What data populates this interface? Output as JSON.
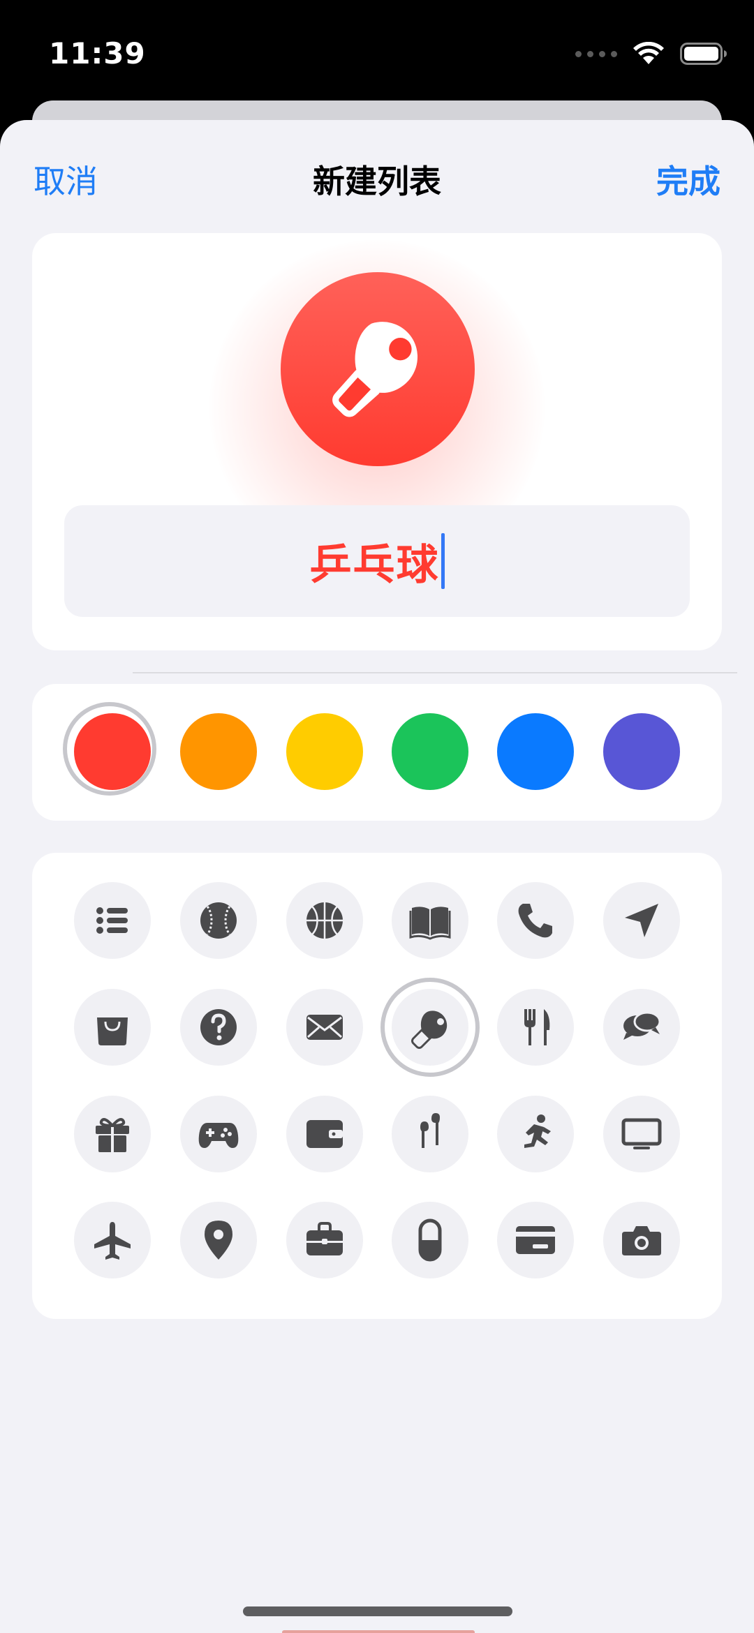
{
  "status_bar": {
    "time": "11:39"
  },
  "nav": {
    "cancel": "取消",
    "title": "新建列表",
    "done": "完成"
  },
  "list": {
    "name": "乒乓球",
    "accent_color": "#ff3b30",
    "selected_icon": "ping-pong-paddle-icon"
  },
  "colors": [
    {
      "name": "red",
      "hex": "#ff3b30",
      "selected": true
    },
    {
      "name": "orange",
      "hex": "#ff9500",
      "selected": false
    },
    {
      "name": "yellow",
      "hex": "#ffcc00",
      "selected": false
    },
    {
      "name": "green",
      "hex": "#1bc45a",
      "selected": false
    },
    {
      "name": "blue",
      "hex": "#0a7aff",
      "selected": false
    },
    {
      "name": "purple",
      "hex": "#5856d6",
      "selected": false
    }
  ],
  "icons": [
    "list-icon",
    "baseball-icon",
    "basketball-icon",
    "book-icon",
    "phone-icon",
    "location-arrow-icon",
    "shopping-bag-icon",
    "question-icon",
    "mail-icon",
    "ping-pong-paddle-icon",
    "fork-knife-icon",
    "chat-bubbles-icon",
    "gift-icon",
    "gamepad-icon",
    "wallet-icon",
    "earbuds-icon",
    "running-icon",
    "tv-icon",
    "airplane-icon",
    "map-pin-icon",
    "briefcase-icon",
    "pill-icon",
    "credit-card-icon",
    "camera-icon"
  ]
}
